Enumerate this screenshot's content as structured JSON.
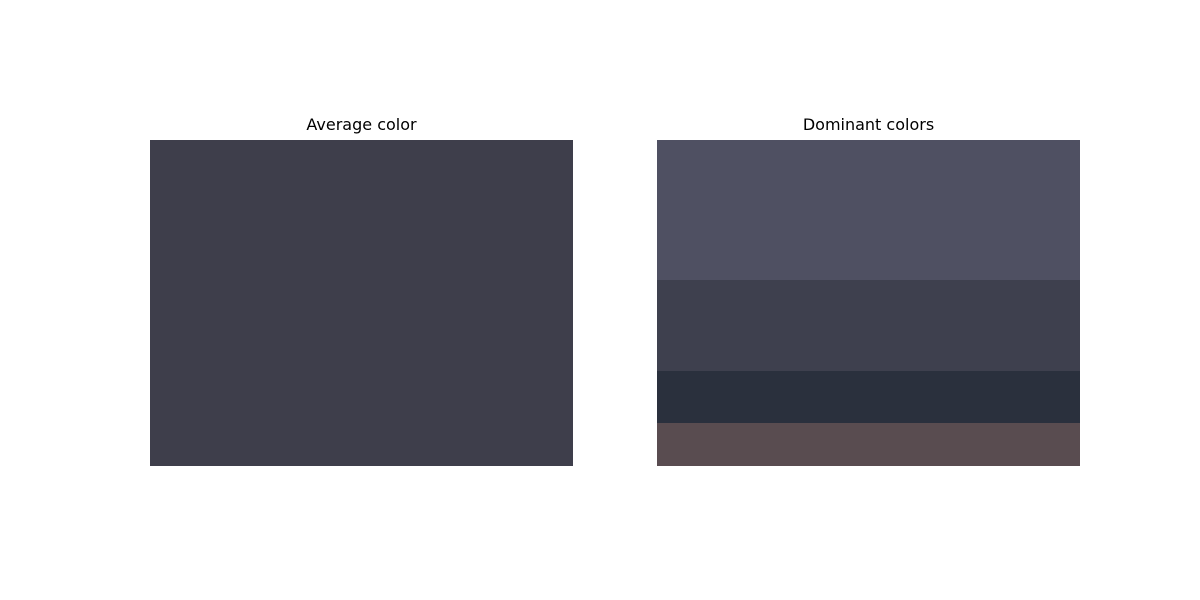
{
  "chart_data": [
    {
      "type": "bar",
      "title": "Average color",
      "swatches": [
        {
          "color": "#3e3e4b",
          "fraction": 1.0
        }
      ]
    },
    {
      "type": "bar",
      "title": "Dominant colors",
      "swatches": [
        {
          "color": "#4f5062",
          "fraction": 0.43
        },
        {
          "color": "#3e404e",
          "fraction": 0.28
        },
        {
          "color": "#2a303d",
          "fraction": 0.16
        },
        {
          "color": "#594c50",
          "fraction": 0.13
        }
      ]
    }
  ]
}
